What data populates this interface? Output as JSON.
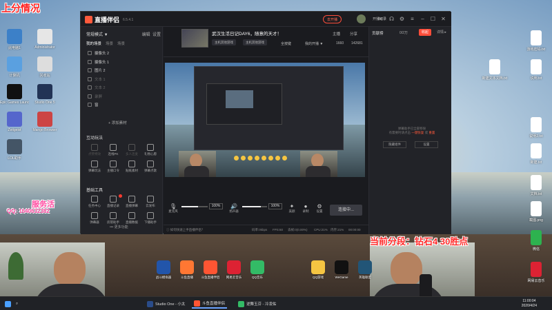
{
  "overlay": {
    "top_left": "上分情况",
    "service": "服务活",
    "service_sub": "QQ: 1640632382",
    "current_rank": "当前分段：钻石4 30胜点"
  },
  "desktop_icons": [
    {
      "label": "此电脑1",
      "color": "#3c80c8"
    },
    {
      "label": "Administrator",
      "color": "#e6e6e6"
    },
    {
      "label": "计算机",
      "color": "#5aa0e0"
    },
    {
      "label": "回收站",
      "color": "#dddddd"
    },
    {
      "label": "Epic Games Launcher",
      "color": "#111111"
    },
    {
      "label": "Studio One 5",
      "color": "#223355"
    },
    {
      "label": "Zeitgeist",
      "color": "#5566cc"
    },
    {
      "label": "Mango Browser",
      "color": "#cc4444"
    },
    {
      "label": "LOL助手",
      "color": "#445566"
    }
  ],
  "right_desktop_icons": [
    {
      "label": "游戏密码.txt",
      "color": "#ffffff"
    },
    {
      "label": "新建文本文档.txt",
      "color": "#ffffff"
    },
    {
      "label": "说明.txt",
      "color": "#ffffff"
    },
    {
      "label": "说明2.txt",
      "color": "#ffffff"
    },
    {
      "label": "新建.txt",
      "color": "#ffffff"
    },
    {
      "label": "文档.txt",
      "color": "#ffffff"
    },
    {
      "label": "截图.png",
      "color": "#ffffff"
    },
    {
      "label": "微信",
      "color": "#2db24f"
    },
    {
      "label": "网易云音乐",
      "color": "#dd2233"
    }
  ],
  "app": {
    "name": "直播伴侣",
    "version": "6.5.4.1",
    "upgrade_btn": "去开播",
    "open_btn": "开播记录",
    "left": {
      "mode": "常规模式 ▼",
      "edit": "编辑",
      "settings": "设置",
      "scene_tabs": [
        "我的场景",
        "场景",
        "场景"
      ],
      "sources": [
        {
          "label": "摄像头 2",
          "dim": false
        },
        {
          "label": "摄像头 1",
          "dim": false
        },
        {
          "label": "图片 2",
          "dim": false
        },
        {
          "label": "文本 1",
          "dim": true
        },
        {
          "label": "文本 2",
          "dim": true
        },
        {
          "label": "录屏",
          "dim": true
        },
        {
          "label": "窗",
          "dim": false
        }
      ],
      "add_source": "+ 添加素材",
      "interactive_title": "互动玩法",
      "interactive": [
        {
          "label": "点赞特效",
          "dim": true
        },
        {
          "label": "连线PK",
          "dim": false
        },
        {
          "label": "多人连麦",
          "dim": true
        },
        {
          "label": "礼物心愿",
          "dim": false
        },
        {
          "label": "弹幕玩法",
          "dim": false
        },
        {
          "label": "主播口令",
          "dim": false
        },
        {
          "label": "贴纸素材",
          "dim": false
        },
        {
          "label": "弹幕点歌",
          "dim": false
        }
      ],
      "tools_title": "基础工具",
      "tools": [
        {
          "label": "任务中心",
          "dim": false
        },
        {
          "label": "直播记录",
          "dim": false
        },
        {
          "label": "直播弹幕",
          "dim": false
        },
        {
          "label": "云发布",
          "dim": false
        },
        {
          "label": "弹幕器",
          "dim": false
        },
        {
          "label": "房管助手",
          "dim": false
        },
        {
          "label": "直播数据",
          "dim": false
        },
        {
          "label": "下播助手",
          "dim": false
        }
      ],
      "more": "••• 更多功能"
    },
    "center": {
      "title": "武汉生活日记DAY6，随意的天才！",
      "categories": [
        "主机其他游戏",
        "主机其他游戏"
      ],
      "tag_btn": "全按键",
      "notice_btn": "我的开播 ▼",
      "followers": "1660",
      "viewers": "142681",
      "share": "分享",
      "anchor": "主播",
      "mic_label": "麦克风",
      "mic_pct": "100%",
      "mic_level": 0.62,
      "speaker_label": "扬声器",
      "speaker_pct": "100%",
      "speaker_level": 0.75,
      "ctrl_icons": [
        {
          "glyph": "✦",
          "label": "美颜"
        },
        {
          "glyph": "●",
          "label": "录制"
        },
        {
          "glyph": "⚙",
          "label": "设置"
        }
      ],
      "live_btn": "连接中...",
      "status": [
        "码率:0kbps",
        "FPS:60",
        "丢帧:0(0.00%)",
        "CPU:21%",
        "内存:21%",
        "00:00:00"
      ],
      "status_notice": "ⓘ 如何快速上手直播伴侣？"
    },
    "right": {
      "title": "贡献榜",
      "rank_tag": "0/2万",
      "btn1": "收起",
      "btn2": "详情 ▸",
      "empty_msg": "弹幕助手已全部移除",
      "empty_msg2": "有需要时请点击",
      "empty_link": "一键恢复",
      "empty_msg3": "或",
      "empty_link2": "重置",
      "btn_hide": "隐藏组件",
      "btn_setting": "设置"
    }
  },
  "tray_apps": [
    {
      "label": "战斗模拟器",
      "color": "#2255aa"
    },
    {
      "label": "斗鱼直播",
      "color": "#ff7733"
    },
    {
      "label": "斗鱼直播伴侣",
      "color": "#ff5533"
    },
    {
      "label": "网易云音乐",
      "color": "#dd2233"
    },
    {
      "label": "QQ音乐",
      "color": "#33bb66"
    }
  ],
  "tray_apps_right": [
    {
      "label": "QQ游戏",
      "color": "#f5c542"
    },
    {
      "label": "WeGame",
      "color": "#111111"
    },
    {
      "label": "英雄联盟",
      "color": "#225577"
    }
  ],
  "taskbar": {
    "items": [
      {
        "label": "Studio One - 小太",
        "color": "#2a4c8a",
        "active": false
      },
      {
        "label": "斗鱼直播伴侣",
        "color": "#ff5533",
        "active": true
      },
      {
        "label": "逆舞玉芬 - 冷凌佑",
        "color": "#33bb66",
        "active": false
      }
    ],
    "time": "11:00:04",
    "date": "2020/4/24"
  }
}
